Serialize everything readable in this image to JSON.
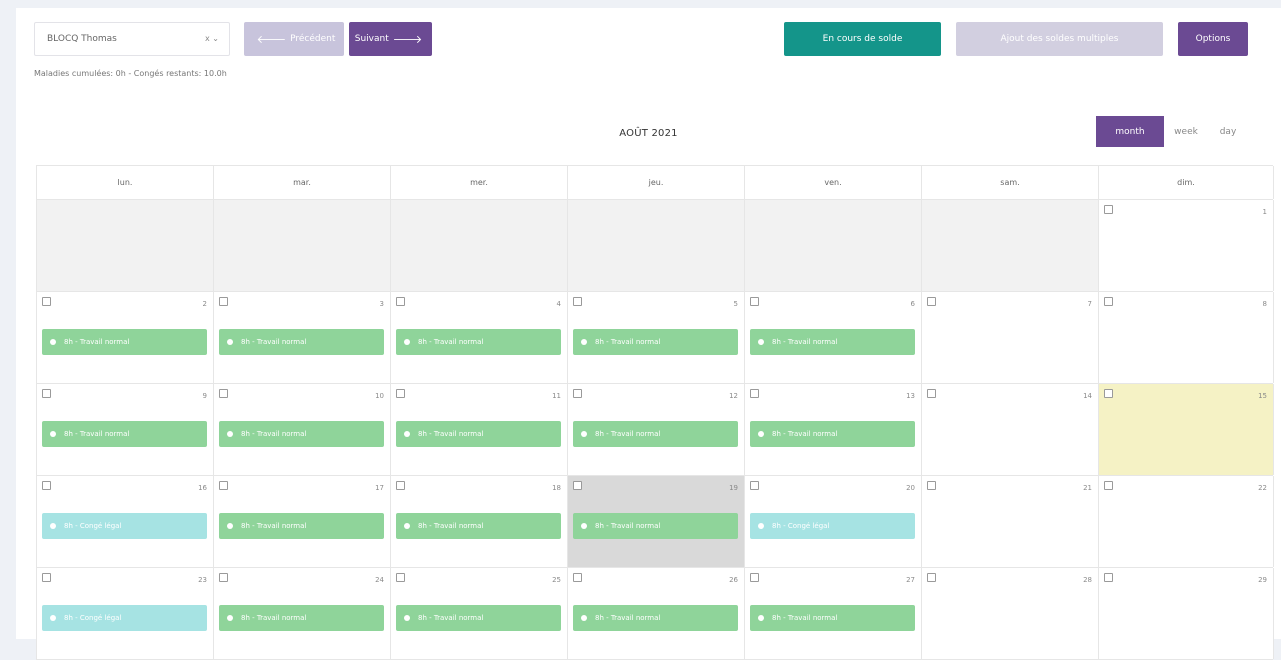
{
  "toolbar": {
    "employee_select": "BLOCQ Thomas",
    "select_controls": "x ⌄",
    "prev_label": "Précédent",
    "next_label": "Suivant",
    "solde_label": "En cours de solde",
    "multi_label": "Ajout des soldes multiples",
    "options_label": "Options"
  },
  "subinfo": "Maladies cumulées: 0h - Congés restants: 10.0h",
  "calendar": {
    "month_title": "AOÛT 2021",
    "views": {
      "month": "month",
      "week": "week",
      "day": "day"
    },
    "weekdays": [
      "lun.",
      "mar.",
      "mer.",
      "jeu.",
      "ven.",
      "sam.",
      "dim."
    ],
    "weeks": [
      [
        {
          "other": true
        },
        {
          "other": true
        },
        {
          "other": true
        },
        {
          "other": true
        },
        {
          "other": true
        },
        {
          "other": true
        },
        {
          "day": "1"
        }
      ],
      [
        {
          "day": "2",
          "event": "8h - Travail normal",
          "type": "work"
        },
        {
          "day": "3",
          "event": "8h - Travail normal",
          "type": "work"
        },
        {
          "day": "4",
          "event": "8h - Travail normal",
          "type": "work"
        },
        {
          "day": "5",
          "event": "8h - Travail normal",
          "type": "work"
        },
        {
          "day": "6",
          "event": "8h - Travail normal",
          "type": "work"
        },
        {
          "day": "7"
        },
        {
          "day": "8"
        }
      ],
      [
        {
          "day": "9",
          "event": "8h - Travail normal",
          "type": "work"
        },
        {
          "day": "10",
          "event": "8h - Travail normal",
          "type": "work"
        },
        {
          "day": "11",
          "event": "8h - Travail normal",
          "type": "work"
        },
        {
          "day": "12",
          "event": "8h - Travail normal",
          "type": "work"
        },
        {
          "day": "13",
          "event": "8h - Travail normal",
          "type": "work"
        },
        {
          "day": "14"
        },
        {
          "day": "15",
          "holiday": true
        }
      ],
      [
        {
          "day": "16",
          "event": "8h - Congé légal",
          "type": "leave"
        },
        {
          "day": "17",
          "event": "8h - Travail normal",
          "type": "work"
        },
        {
          "day": "18",
          "event": "8h - Travail normal",
          "type": "work"
        },
        {
          "day": "19",
          "event": "8h - Travail normal",
          "type": "work",
          "today": true
        },
        {
          "day": "20",
          "event": "8h - Congé légal",
          "type": "leave"
        },
        {
          "day": "21"
        },
        {
          "day": "22"
        }
      ],
      [
        {
          "day": "23",
          "event": "8h - Congé légal",
          "type": "leave"
        },
        {
          "day": "24",
          "event": "8h - Travail normal",
          "type": "work"
        },
        {
          "day": "25",
          "event": "8h - Travail normal",
          "type": "work"
        },
        {
          "day": "26",
          "event": "8h - Travail normal",
          "type": "work"
        },
        {
          "day": "27",
          "event": "8h - Travail normal",
          "type": "work"
        },
        {
          "day": "28"
        },
        {
          "day": "29"
        }
      ]
    ]
  }
}
